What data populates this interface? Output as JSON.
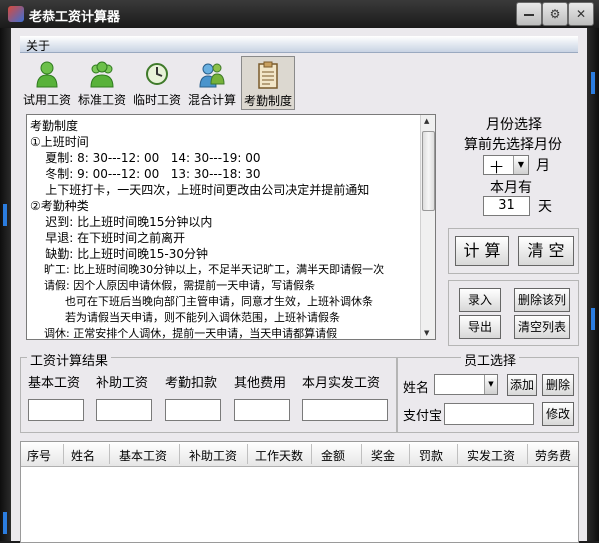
{
  "window": {
    "title": "老恭工资计算器"
  },
  "menu": {
    "about": "关于"
  },
  "toolbar": [
    {
      "label": "试用工资",
      "icon": "single-person-icon"
    },
    {
      "label": "标准工资",
      "icon": "group-people-icon"
    },
    {
      "label": "临时工资",
      "icon": "clock-icon"
    },
    {
      "label": "混合计算",
      "icon": "two-people-icon"
    },
    {
      "label": "考勤制度",
      "icon": "clipboard-icon",
      "active": true
    }
  ],
  "attendance_text": [
    "考勤制度",
    "①上班时间",
    "    夏制: 8: 30---12: 00   14: 30---19: 00",
    "    冬制: 9: 00---12: 00   13: 30---18: 30",
    "    上下班打卡，一天四次，上班时间更改由公司决定并提前通知",
    "②考勤种类",
    "    迟到: 比上班时间晚15分钟以内",
    "    早退: 在下班时间之前离开",
    "    缺勤: 比上班时间晚15-30分钟",
    "    旷工: 比上班时间晚30分钟以上，不足半天记旷工，满半天即请假一次",
    "    请假: 因个人原因申请休假，需提前一天申请，写请假条",
    "          也可在下班后当晚向部门主管申请，同意才生效，上班补调休条",
    "          若为请假当天申请，则不能列入调休范围，上班补请假条",
    "    调休: 正常安排个人调休，提前一天申请，当天申请都算请假"
  ],
  "month_select": {
    "title": "月份选择",
    "hint": "算前先选择月份",
    "month_value": "十",
    "month_unit": "月",
    "days_label": "本月有",
    "days_value": "31",
    "days_unit": "天"
  },
  "actions": {
    "calculate": "计 算",
    "clear": "清 空"
  },
  "list_actions": {
    "record": "录入",
    "delete_row": "删除该列",
    "export": "导出",
    "clear_list": "清空列表"
  },
  "results": {
    "title": "工资计算结果",
    "columns": [
      "基本工资",
      "补助工资",
      "考勤扣款",
      "其他费用",
      "本月实发工资"
    ]
  },
  "employee": {
    "title": "员工选择",
    "name_label": "姓名",
    "add": "添加",
    "delete": "删除",
    "alipay_label": "支付宝",
    "modify": "修改"
  },
  "table": {
    "headers": [
      "序号",
      "姓名",
      "基本工资",
      "补助工资",
      "工作天数",
      "金额",
      "奖金",
      "罚款",
      "实发工资",
      "劳务费"
    ]
  }
}
